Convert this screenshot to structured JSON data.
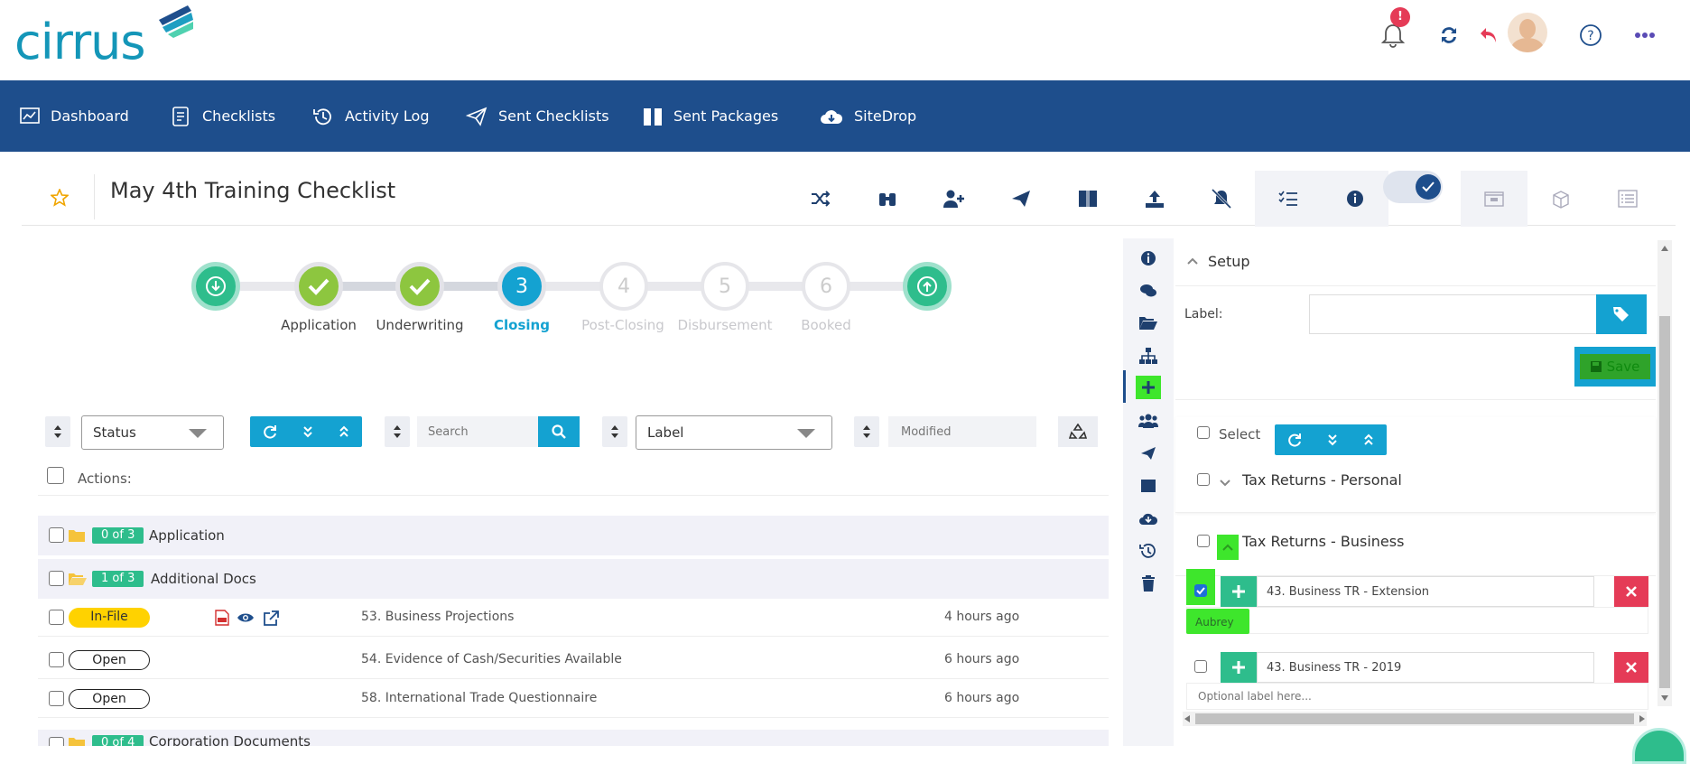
{
  "brand": {
    "logo_text": "cirrus",
    "accent": "#1496b8",
    "nav_bg": "#1e4e8c",
    "green": "#2ebd8c",
    "teal_button": "#14a2d1"
  },
  "header": {
    "icons": [
      "bell-alert-icon",
      "sync-icon",
      "undo-icon",
      "avatar",
      "help-icon",
      "more-icon"
    ],
    "alert_badge": "!"
  },
  "nav": {
    "items": [
      {
        "label": "Dashboard",
        "icon": "dashboard-icon"
      },
      {
        "label": "Checklists",
        "icon": "checklist-icon"
      },
      {
        "label": "Activity Log",
        "icon": "history-icon"
      },
      {
        "label": "Sent Checklists",
        "icon": "paper-plane-icon"
      },
      {
        "label": "Sent Packages",
        "icon": "package-icon"
      },
      {
        "label": "SiteDrop",
        "icon": "cloud-download-icon"
      }
    ]
  },
  "title": {
    "text": "May 4th Training Checklist"
  },
  "toolbar": {
    "icons": [
      "shuffle-icon",
      "binoculars-icon",
      "add-user-icon",
      "send-icon",
      "box-icon",
      "upload-icon",
      "bell-off-icon",
      "tasks-icon",
      "info-icon",
      "toggle",
      "folder-icon",
      "package-open-icon",
      "list-icon"
    ]
  },
  "steps": {
    "items": [
      {
        "label": "",
        "state": "start"
      },
      {
        "label": "Application",
        "state": "done"
      },
      {
        "label": "Underwriting",
        "state": "done"
      },
      {
        "label": "Closing",
        "state": "active",
        "number": "3"
      },
      {
        "label": "Post-Closing",
        "state": "future",
        "number": "4"
      },
      {
        "label": "Disbursement",
        "state": "future",
        "number": "5"
      },
      {
        "label": "Booked",
        "state": "future",
        "number": "6"
      },
      {
        "label": "",
        "state": "end"
      }
    ]
  },
  "filters": {
    "status": "Status",
    "search_placeholder": "Search",
    "label": "Label",
    "modified_placeholder": "Modified"
  },
  "actions": {
    "label": "Actions:"
  },
  "folders": [
    {
      "badge": "0 of 3",
      "name": "Application"
    },
    {
      "badge": "1 of 3",
      "name": "Additional Docs"
    },
    {
      "badge": "0 of 4",
      "name": "Corporation Documents"
    }
  ],
  "files": [
    {
      "status": "In-File",
      "name": "53. Business Projections",
      "time": "4 hours ago"
    },
    {
      "status": "Open",
      "name": "54. Evidence of Cash/Securities Available",
      "time": "6 hours ago"
    },
    {
      "status": "Open",
      "name": "58. International Trade Questionnaire",
      "time": "6 hours ago"
    }
  ],
  "panel": {
    "setup_title": "Setup",
    "label_field": "Label:",
    "save": "Save",
    "select": "Select",
    "groups": [
      {
        "name": "Tax Returns - Personal"
      },
      {
        "name": "Tax Returns - Business"
      }
    ],
    "items": [
      {
        "name": "43. Business TR - Extension",
        "label_value": "Aubrey",
        "checked": true
      },
      {
        "name": "43. Business TR - 2019",
        "label_placeholder": "Optional label here...",
        "checked": false
      }
    ]
  }
}
